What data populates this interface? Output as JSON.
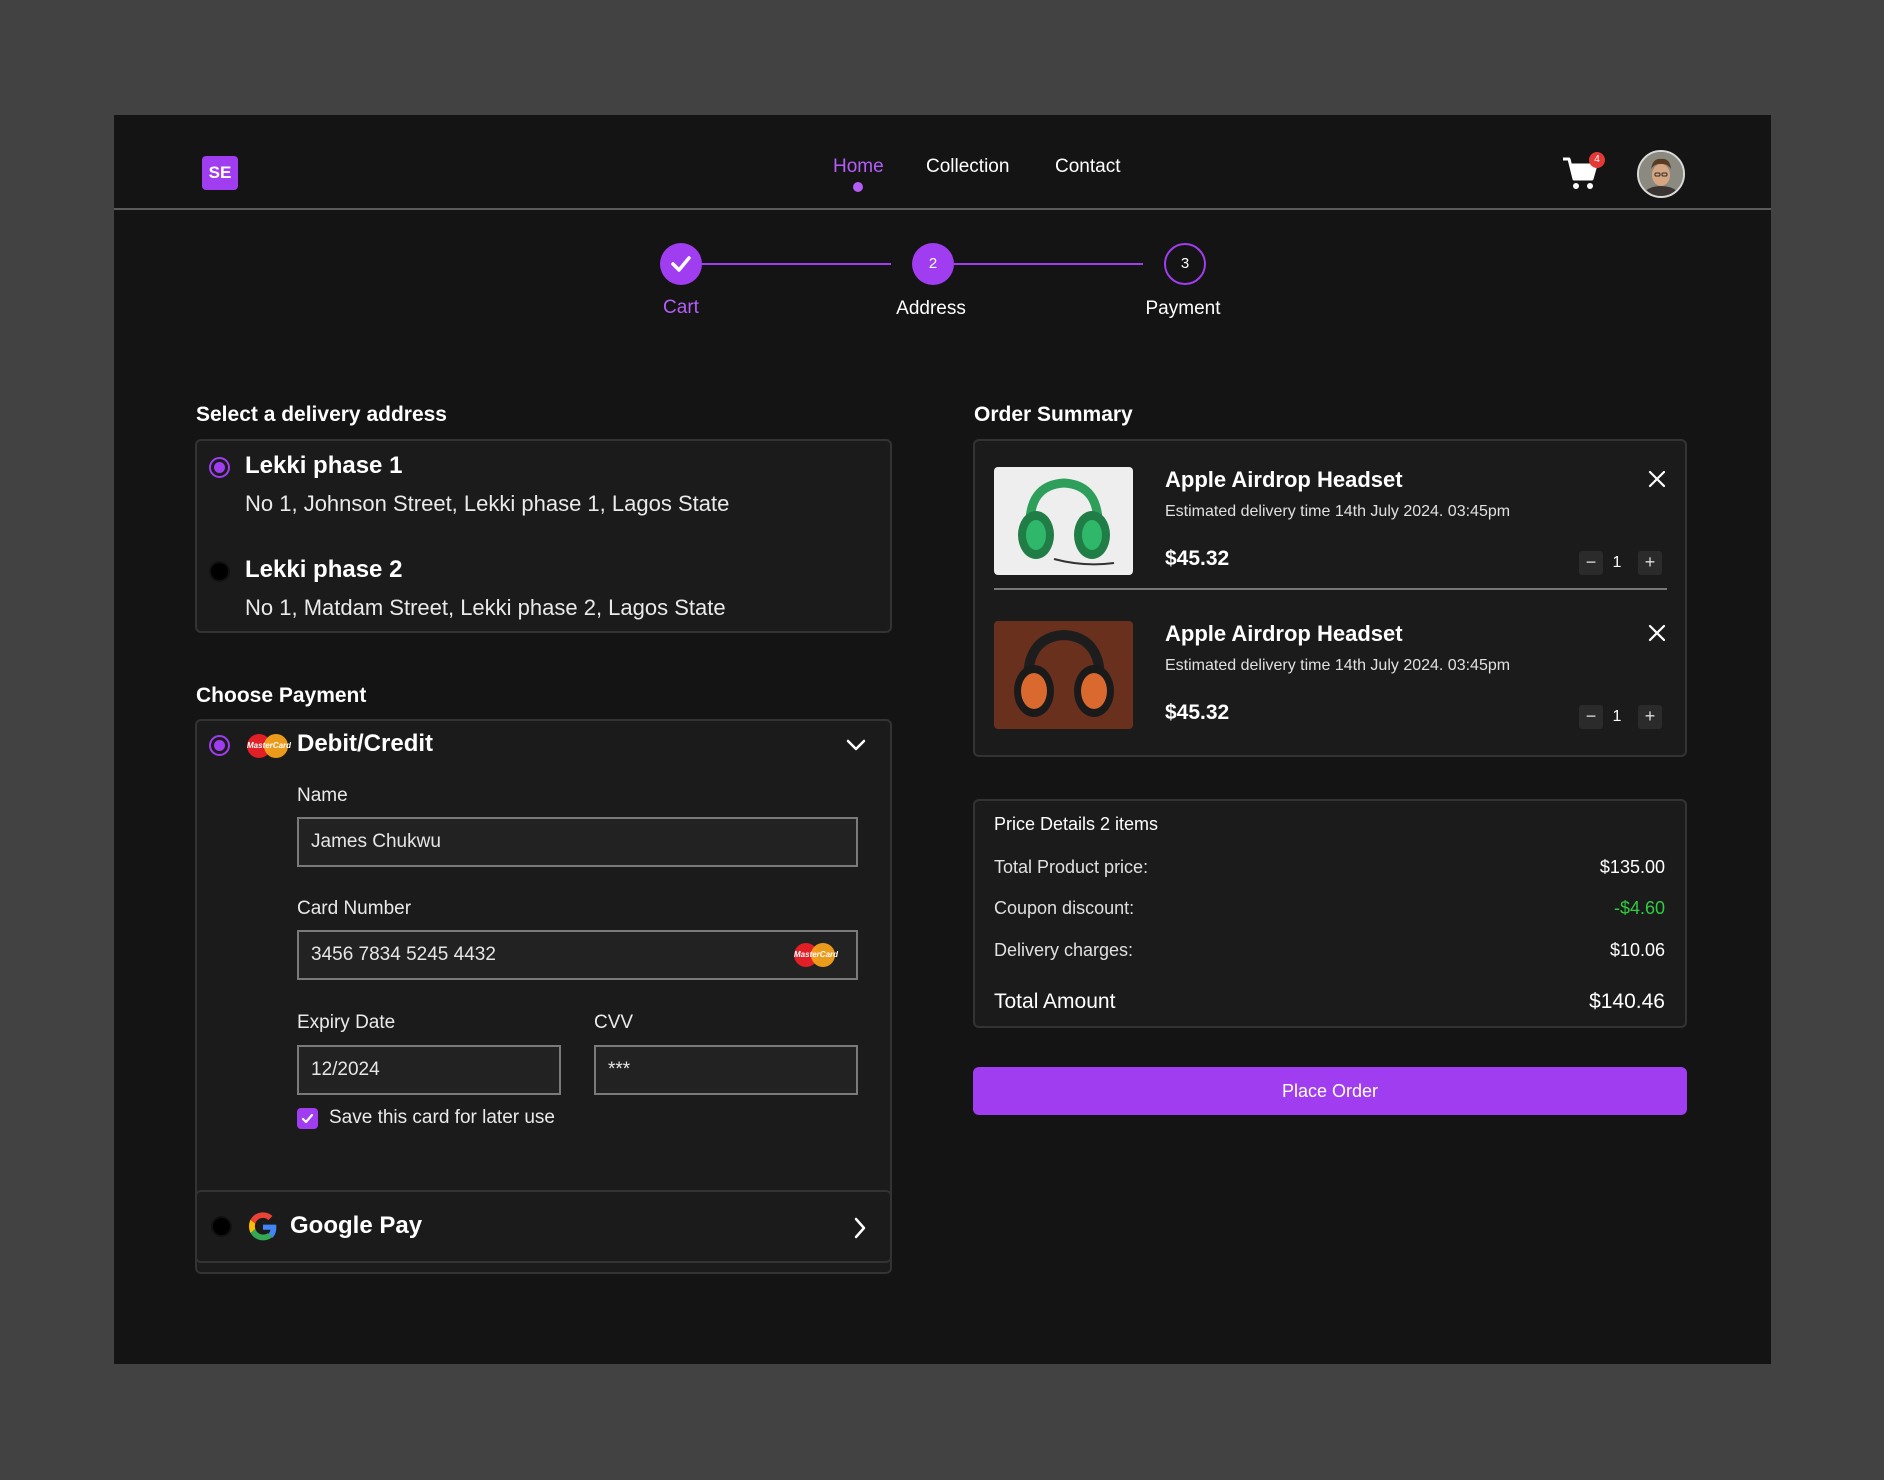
{
  "header": {
    "logo": "SE",
    "nav": [
      "Home",
      "Collection",
      "Contact"
    ],
    "active_nav": "Home",
    "cart_count": "4"
  },
  "stepper": {
    "steps": [
      {
        "number": "✓",
        "label": "Cart",
        "state": "done"
      },
      {
        "number": "2",
        "label": "Address",
        "state": "current"
      },
      {
        "number": "3",
        "label": "Payment",
        "state": "upcoming"
      }
    ]
  },
  "address": {
    "title": "Select  a delivery address",
    "options": [
      {
        "name": "Lekki phase 1",
        "line": "No 1, Johnson Street, Lekki phase 1, Lagos State",
        "selected": true
      },
      {
        "name": "Lekki phase 2",
        "line": "No 1, Matdam Street, Lekki phase 2, Lagos State",
        "selected": false
      }
    ]
  },
  "payment": {
    "title": "Choose Payment",
    "card_method_label": "Debit/Credit",
    "card_logo_text": "MasterCard",
    "name_label": "Name",
    "name_value": "James Chukwu",
    "card_number_label": "Card Number",
    "card_number_value": "3456 7834 5245 4432",
    "expiry_label": "Expiry Date",
    "expiry_value": "12/2024",
    "cvv_label": "CVV",
    "cvv_value": "***",
    "save_card_label": "Save this card for later use",
    "save_card_checked": true,
    "google_pay_label": "Google Pay"
  },
  "order_summary": {
    "title": "Order Summary",
    "items": [
      {
        "name": "Apple Airdrop Headset",
        "delivery": "Estimated delivery time 14th July 2024. 03:45pm",
        "price": "$45.32",
        "qty": "1",
        "image": "green-headphones"
      },
      {
        "name": "Apple Airdrop Headset",
        "delivery": "Estimated delivery time 14th July 2024. 03:45pm",
        "price": "$45.32",
        "qty": "1",
        "image": "orange-headphones"
      }
    ]
  },
  "price_details": {
    "title": "Price Details 2 items",
    "total_product_label": "Total Product price:",
    "total_product_value": "$135.00",
    "coupon_label": "Coupon discount:",
    "coupon_value": "-$4.60",
    "delivery_label": "Delivery charges:",
    "delivery_value": "$10.06",
    "total_label": "Total Amount",
    "total_value": "$140.46"
  },
  "place_order_label": "Place Order",
  "colors": {
    "accent": "#a03df0",
    "background": "#141414",
    "panel": "#1b1b1b",
    "discount": "#2ecc40",
    "badge": "#e53935"
  }
}
